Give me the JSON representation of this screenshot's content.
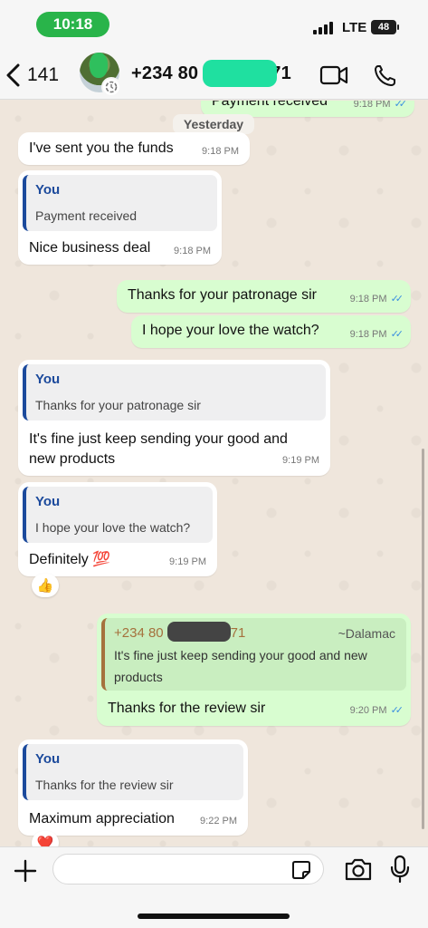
{
  "status_bar": {
    "time": "10:18",
    "network": "LTE",
    "battery": "48"
  },
  "header": {
    "back_count": "141",
    "contact_name": "+234 80",
    "contact_name_end": "71"
  },
  "chat": {
    "top_partial": {
      "text": "Payment received",
      "time": "9:18 PM"
    },
    "date_divider": "Yesterday",
    "messages": [
      {
        "dir": "in",
        "text": "I've sent you the funds",
        "time": "9:18 PM"
      },
      {
        "dir": "in",
        "quote_name": "You",
        "quote_text": "Payment received",
        "text": "Nice business deal",
        "time": "9:18 PM"
      },
      {
        "dir": "out",
        "text": "Thanks for your patronage sir",
        "time": "9:18 PM"
      },
      {
        "dir": "out",
        "text": "I hope your love the watch?",
        "time": "9:18 PM"
      },
      {
        "dir": "in",
        "quote_name": "You",
        "quote_text": "Thanks for your patronage sir",
        "text_line1": "It's fine just keep sending your good and",
        "text_line2": "new products",
        "time": "9:19 PM"
      },
      {
        "dir": "in",
        "quote_name": "You",
        "quote_text": "I hope your love the watch?",
        "text": "Definitely 💯",
        "time": "9:19 PM",
        "reaction": "👍"
      },
      {
        "dir": "out",
        "quote_name": "+234 80",
        "quote_name_end": "71",
        "quote_alias": "~Dalamac",
        "quote_line1": "It's fine just keep sending your good and new",
        "quote_line2": "products",
        "text": "Thanks for the review sir",
        "time": "9:20 PM"
      },
      {
        "dir": "in",
        "quote_name": "You",
        "quote_text": "Thanks for the review sir",
        "text": "Maximum appreciation",
        "time": "9:22 PM",
        "reaction": "❤️"
      }
    ]
  },
  "icons": [
    "back-chevron-icon",
    "video-call-icon",
    "voice-call-icon",
    "plus-icon",
    "sticker-icon",
    "camera-icon",
    "mic-icon",
    "double-check-icon"
  ],
  "colors": {
    "outgoing": "#d8fdd0",
    "incoming": "#ffffff",
    "quote_bar": "#1c4a9c",
    "ticks": "#3b8fe0"
  }
}
